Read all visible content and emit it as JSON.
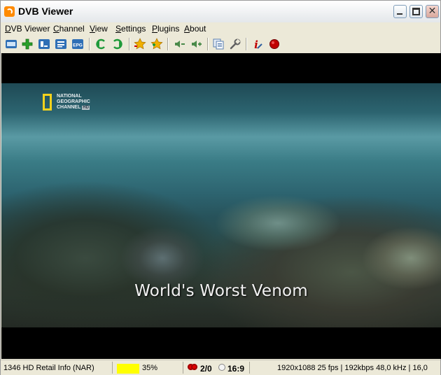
{
  "window": {
    "title": "DVB Viewer"
  },
  "menu": [
    "DVB Viewer",
    "Channel",
    "View",
    "Settings",
    "Plugins",
    "About"
  ],
  "toolbar": {
    "buttons": [
      {
        "name": "display-icon",
        "color": "#2f6fb6"
      },
      {
        "name": "plus-icon",
        "color": "#2aa02a"
      },
      {
        "name": "screen-icon",
        "color": "#2f6fb6"
      },
      {
        "name": "teletext-icon",
        "color": "#2f6fb6"
      },
      {
        "name": "epg-icon",
        "label": "EPG",
        "color": "#2f6fb6"
      },
      {
        "name": "prev-channel-icon",
        "color": "#1f9a3a"
      },
      {
        "name": "next-channel-icon",
        "color": "#1f9a3a"
      },
      {
        "name": "favorites-icon",
        "color": "#f0b000"
      },
      {
        "name": "add-favorite-icon",
        "color": "#f0b000"
      },
      {
        "name": "volume-down-icon",
        "color": "#4a8a4a"
      },
      {
        "name": "volume-up-icon",
        "color": "#4a8a4a"
      },
      {
        "name": "copy-icon",
        "color": "#5a7fb0"
      },
      {
        "name": "settings-wrench-icon",
        "color": "#606060"
      },
      {
        "name": "info-icon",
        "color": "#c00000"
      },
      {
        "name": "record-icon",
        "color": "#c00000"
      }
    ]
  },
  "video": {
    "channel_logo": {
      "line1": "NATIONAL",
      "line2": "GEOGRAPHIC",
      "line3": "CHANNEL",
      "badge": "HD"
    },
    "subtitle": "World's Worst Venom"
  },
  "status": {
    "channel": "1346 HD Retail Info (NAR)",
    "signal_percent": "35%",
    "signal_fraction": 0.35,
    "audio_tracks": "2/0",
    "aspect": "16:9",
    "stream_info": "1920x1088 25 fps | 192kbps 48,0 kHz | 16,0"
  }
}
